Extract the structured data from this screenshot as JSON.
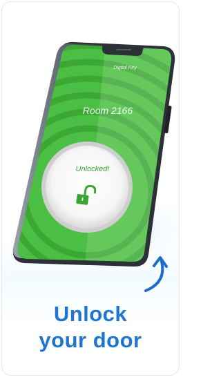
{
  "screen": {
    "header_label": "Digital Key",
    "room_label": "Room 2166",
    "status_label": "Unlocked!",
    "status_icon": "unlocked-padlock-icon"
  },
  "headline": {
    "line1": "Unlock",
    "line2": "your door"
  },
  "colors": {
    "screen_green": "#4bbf43",
    "headline_blue": "#1d77d1",
    "arrow_blue": "#1b6fc7"
  }
}
